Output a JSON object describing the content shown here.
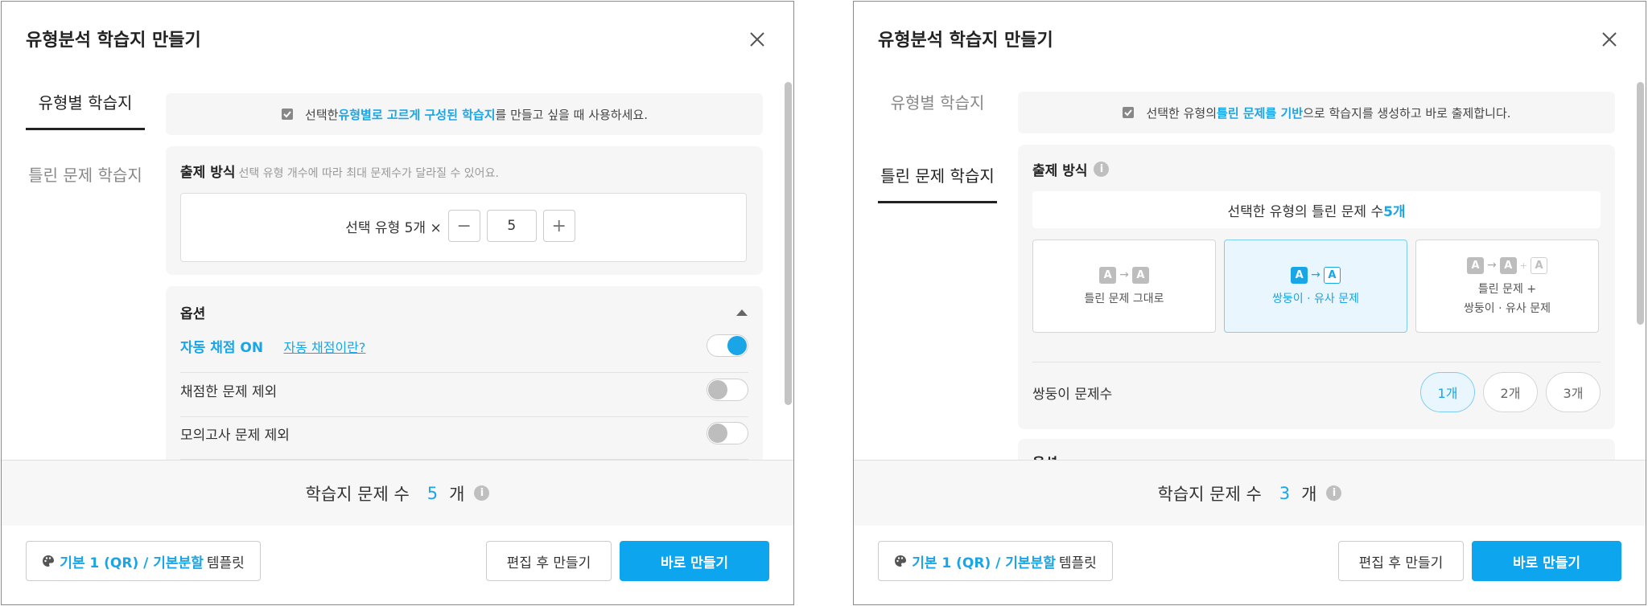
{
  "left": {
    "title": "유형분석 학습지 만들기",
    "tabs": [
      {
        "label": "유형별 학습지"
      },
      {
        "label": "틀린 문제 학습지"
      }
    ],
    "notice": {
      "pre": "선택한 ",
      "highlight": "유형별로 고르게 구성된 학습지",
      "post": "를 만들고 싶을 때 사용하세요."
    },
    "method": {
      "title": "출제 방식",
      "subtitle": "선택 유형 개수에 따라 최대 문제수가 달라질 수 있어요.",
      "stepper_label": "선택 유형 5개 ×",
      "minus": "−",
      "value": "5",
      "plus": "+"
    },
    "options": {
      "title": "옵션",
      "auto_grading": "자동 채점 ON",
      "auto_link": "자동 채점이란?",
      "exclude_graded": "채점한 문제 제외",
      "exclude_mock": "모의고사 문제 제외",
      "toggles": {
        "auto": true,
        "graded": false,
        "mock": false
      }
    },
    "footer": {
      "label": "학습지 문제 수",
      "count": "5",
      "unit": "개"
    },
    "template": {
      "highlight": "기본 1 (QR) / 기본분할",
      "suffix": "템플릿"
    },
    "edit_button": "편집 후 만들기",
    "create_button": "바로 만들기"
  },
  "right": {
    "title": "유형분석 학습지 만들기",
    "tabs": [
      {
        "label": "유형별 학습지"
      },
      {
        "label": "틀린 문제 학습지"
      }
    ],
    "notice": {
      "pre": "선택한 유형의 ",
      "highlight": "틀린 문제를 기반",
      "post": "으로 학습지를 생성하고 바로 출제합니다."
    },
    "method": {
      "title": "출제 방식",
      "wrong_pre": "선택한 유형의 틀린 문제 수 ",
      "wrong_count": "5개",
      "cards": [
        {
          "label1": "틀린 문제 그대로",
          "label2": ""
        },
        {
          "label1": "쌍둥이 · 유사 문제",
          "label2": ""
        },
        {
          "label1": "틀린 문제 +",
          "label2": "쌍둥이 · 유사 문제"
        }
      ],
      "a_letter": "A",
      "arrow": "→",
      "plus_sep": "+"
    },
    "twins": {
      "label": "쌍둥이 문제수",
      "options": [
        "1개",
        "2개",
        "3개"
      ],
      "selected": "1개"
    },
    "options_peek": "옵션",
    "footer": {
      "label": "학습지 문제 수",
      "count": "3",
      "unit": "개"
    },
    "template": {
      "highlight": "기본 1 (QR) / 기본분할",
      "suffix": "템플릿"
    },
    "edit_button": "편집 후 만들기",
    "create_button": "바로 만들기"
  },
  "colors": {
    "accent": "#1aa5e6",
    "primary_button": "#0ea5ef"
  }
}
